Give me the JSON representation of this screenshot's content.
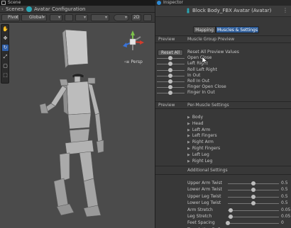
{
  "tabs": {
    "scene": "Scene",
    "inspector": "Inspector"
  },
  "scene": {
    "breadcrumb_root": "Scenes",
    "breadcrumb_current": "Avatar Configuration",
    "toolbar": {
      "pivot": "Pivot",
      "global": "Global",
      "mode_2d": "2D"
    },
    "persp_label": "Persp",
    "colors": {
      "viewport_bg": "#4b4b4b",
      "active_tool": "#2e5ea8",
      "figure_light": "#bdbdbd",
      "figure_dark": "#8a8a8a"
    },
    "icons": [
      "hand-icon",
      "move-icon",
      "rotate-icon",
      "scale-icon",
      "rect-icon",
      "transform-icon"
    ]
  },
  "inspector": {
    "title": "Block Body_FBX Avatar (Avatar)",
    "tab_mapping": "Mapping",
    "tab_muscles": "Muscles & Settings",
    "preview_label": "Preview",
    "muscle_group_preview": "Muscle Group Preview",
    "reset_all": "Reset All",
    "group_rows": [
      "Reset All Preview Values",
      "Open Close",
      "Left Right",
      "Roll Left Right",
      "In Out",
      "Roll In Out",
      "Finger Open Close",
      "Finger In Out"
    ],
    "preview_label2": "Preview",
    "per_muscle_settings": "Per-Muscle Settings",
    "per_muscle_items": [
      "Body",
      "Head",
      "Left Arm",
      "Left Fingers",
      "Right Arm",
      "Right Fingers",
      "Left Leg",
      "Right Leg"
    ],
    "additional_settings": "Additional Settings",
    "additional": [
      {
        "label": "Upper Arm Twist",
        "value": "0.5",
        "fraction": 0.5
      },
      {
        "label": "Lower Arm Twist",
        "value": "0.5",
        "fraction": 0.5
      },
      {
        "label": "Upper Leg Twist",
        "value": "0.5",
        "fraction": 0.5
      },
      {
        "label": "Lower Leg Twist",
        "value": "0.5",
        "fraction": 0.5
      },
      {
        "label": "Arm Stretch",
        "value": "0.05",
        "fraction": 0.05
      },
      {
        "label": "Leg Stretch",
        "value": "0.05",
        "fraction": 0.05
      },
      {
        "label": "Feet Spacing",
        "value": "0",
        "fraction": 0.0
      },
      {
        "label": "Translation DoF",
        "value": "",
        "fraction": null
      }
    ],
    "colors": {
      "panel_bg": "#383838",
      "tab_active": "#2f5d98"
    }
  }
}
